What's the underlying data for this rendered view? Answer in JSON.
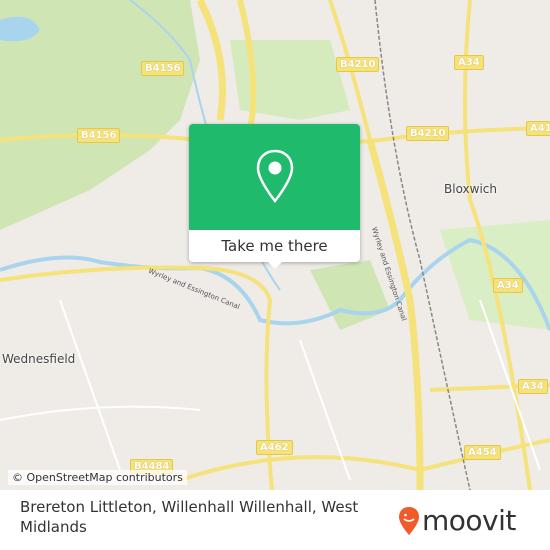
{
  "map": {
    "road_labels": [
      "B4156",
      "B4156",
      "B4210",
      "A34",
      "B4210",
      "A41",
      "A34",
      "A34",
      "A462",
      "B4484",
      "A454"
    ],
    "places": [
      "Bloxwich",
      "Wednesfield"
    ],
    "canals": [
      "Wyrley and Essington Canal",
      "Wyrley and Essington Canal"
    ],
    "attribution": "© OpenStreetMap contributors",
    "colors": {
      "water": "#a8d4ee",
      "park": "#cde8b0",
      "road": "#f6e27a",
      "accent": "#1fba6b"
    }
  },
  "popup": {
    "icon": "map-pin-icon",
    "button_label": "Take me there"
  },
  "footer": {
    "address": "Brereton Littleton, Willenhall Willenhall, West Midlands",
    "logo": "moovit",
    "logo_color": "#f15a29"
  }
}
